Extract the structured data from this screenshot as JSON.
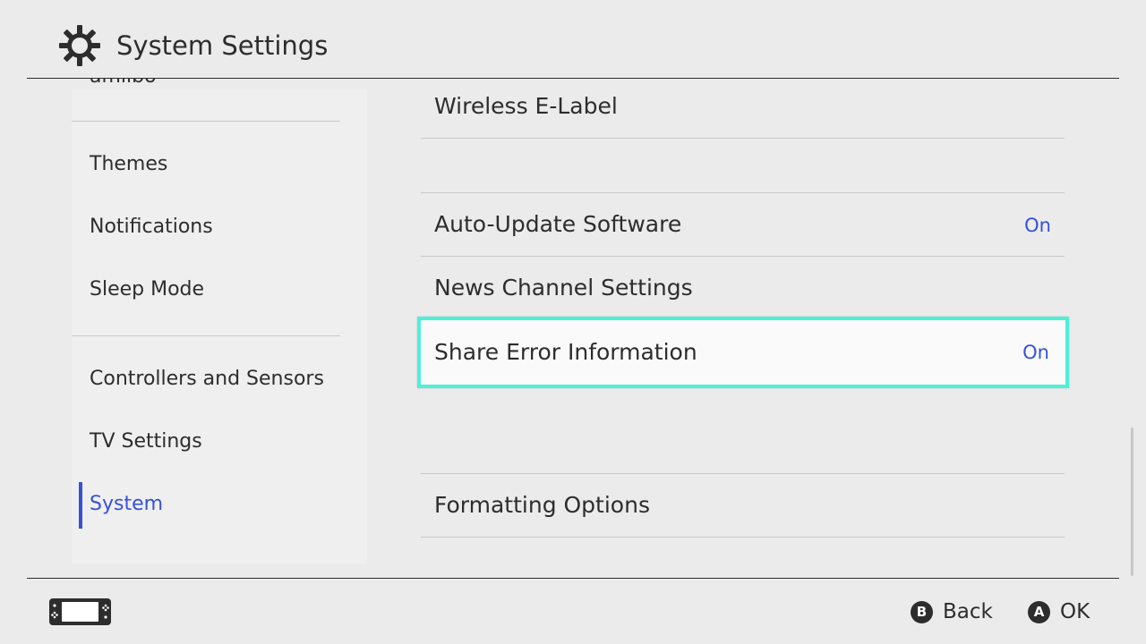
{
  "header": {
    "title": "System Settings",
    "icon": "gear-icon"
  },
  "sidebar": {
    "items": [
      {
        "label": "amiibo",
        "active": false
      },
      {
        "label": "Themes",
        "active": false
      },
      {
        "label": "Notifications",
        "active": false
      },
      {
        "label": "Sleep Mode",
        "active": false
      },
      {
        "label": "Controllers and Sensors",
        "active": false
      },
      {
        "label": "TV Settings",
        "active": false
      },
      {
        "label": "System",
        "active": true
      }
    ]
  },
  "main": {
    "rows": [
      {
        "label": "Wireless E-Label",
        "value": ""
      },
      {
        "label": "Auto-Update Software",
        "value": "On"
      },
      {
        "label": "News Channel Settings",
        "value": ""
      },
      {
        "label": "Share Error Information",
        "value": "On",
        "selected": true
      },
      {
        "label": "Formatting Options",
        "value": ""
      }
    ]
  },
  "footer": {
    "console_icon": "handheld-console-icon",
    "back": {
      "glyph": "B",
      "label": "Back"
    },
    "ok": {
      "glyph": "A",
      "label": "OK"
    }
  },
  "colors": {
    "background": "#ebebeb",
    "accent": "#3651d6",
    "selection_border": "#4ef0d8",
    "text": "#2d2d2d"
  }
}
